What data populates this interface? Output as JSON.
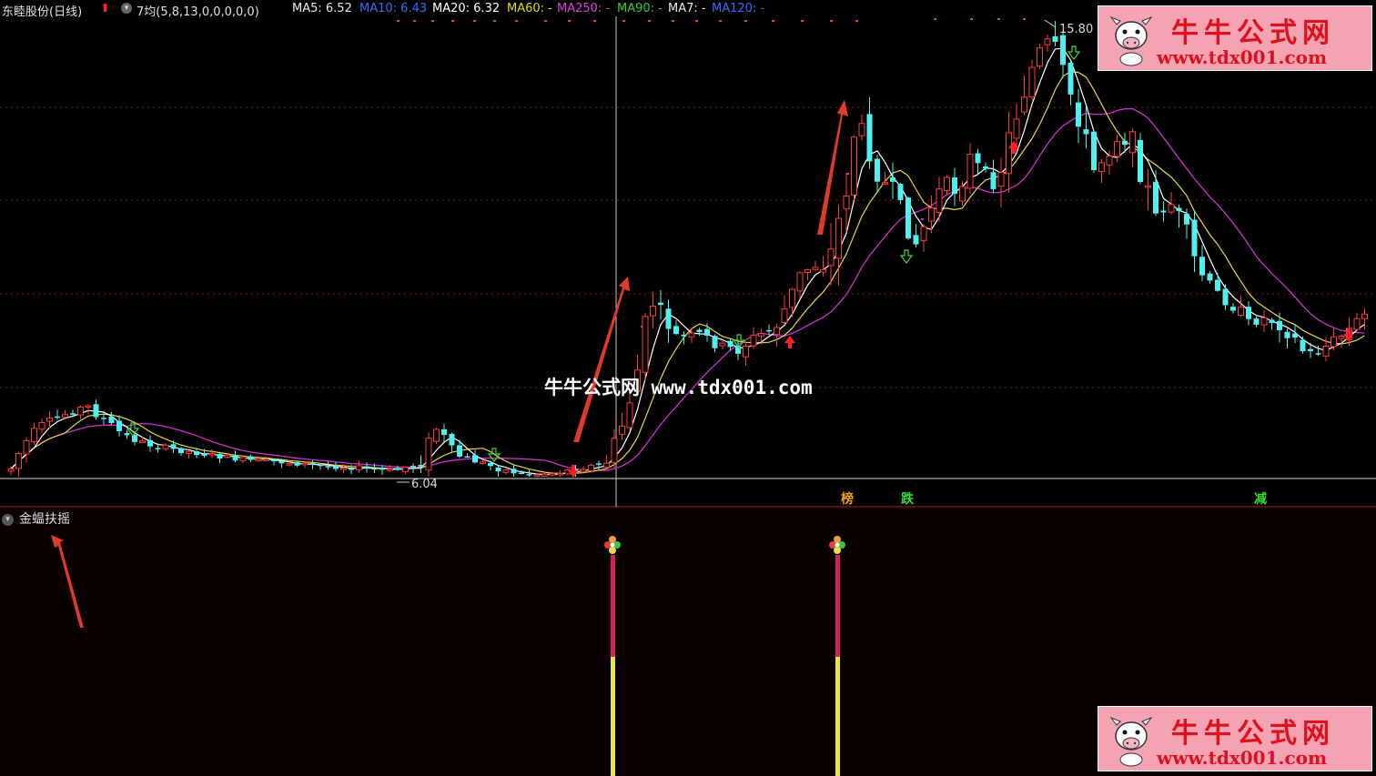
{
  "header": {
    "stock_name": "东睦股份(日线)",
    "indicator_name": "7均(5,8,13,0,0,0,0,0)",
    "ma_items": [
      {
        "label": "MA5: 6.52",
        "color": "#e8e8e8"
      },
      {
        "label": "MA10: 6.43",
        "color": "#3a6cff"
      },
      {
        "label": "MA20: 6.32",
        "color": "#ffffff"
      },
      {
        "label": "MA60: -",
        "color": "#e8d800"
      },
      {
        "label": "MA250: -",
        "color": "#e040e0"
      },
      {
        "label": "MA90: -",
        "color": "#30d030"
      },
      {
        "label": "MA7: -",
        "color": "#e8e8e8"
      },
      {
        "label": "MA120: -",
        "color": "#3a6cff"
      }
    ]
  },
  "price_labels": {
    "high": "15.80",
    "low": "6.04"
  },
  "event_labels": [
    {
      "text": "榜",
      "color": "#f0a020"
    },
    {
      "text": "跌",
      "color": "#30e030"
    },
    {
      "text": "减",
      "color": "#30e030"
    }
  ],
  "sub_indicator": {
    "name": "金蝹扶摇"
  },
  "watermark": {
    "center_cn": "牛牛公式网",
    "center_url": "www.tdx001.com",
    "logo_cn": "牛牛公式网",
    "logo_url": "www.tdx001.com"
  },
  "colors": {
    "up": "#ff3a3a",
    "down": "#4ff0f0",
    "ma_white": "#ffffff",
    "ma_yellow": "#e8d840",
    "ma_magenta": "#d030d0",
    "grid": "#7a1010"
  }
}
